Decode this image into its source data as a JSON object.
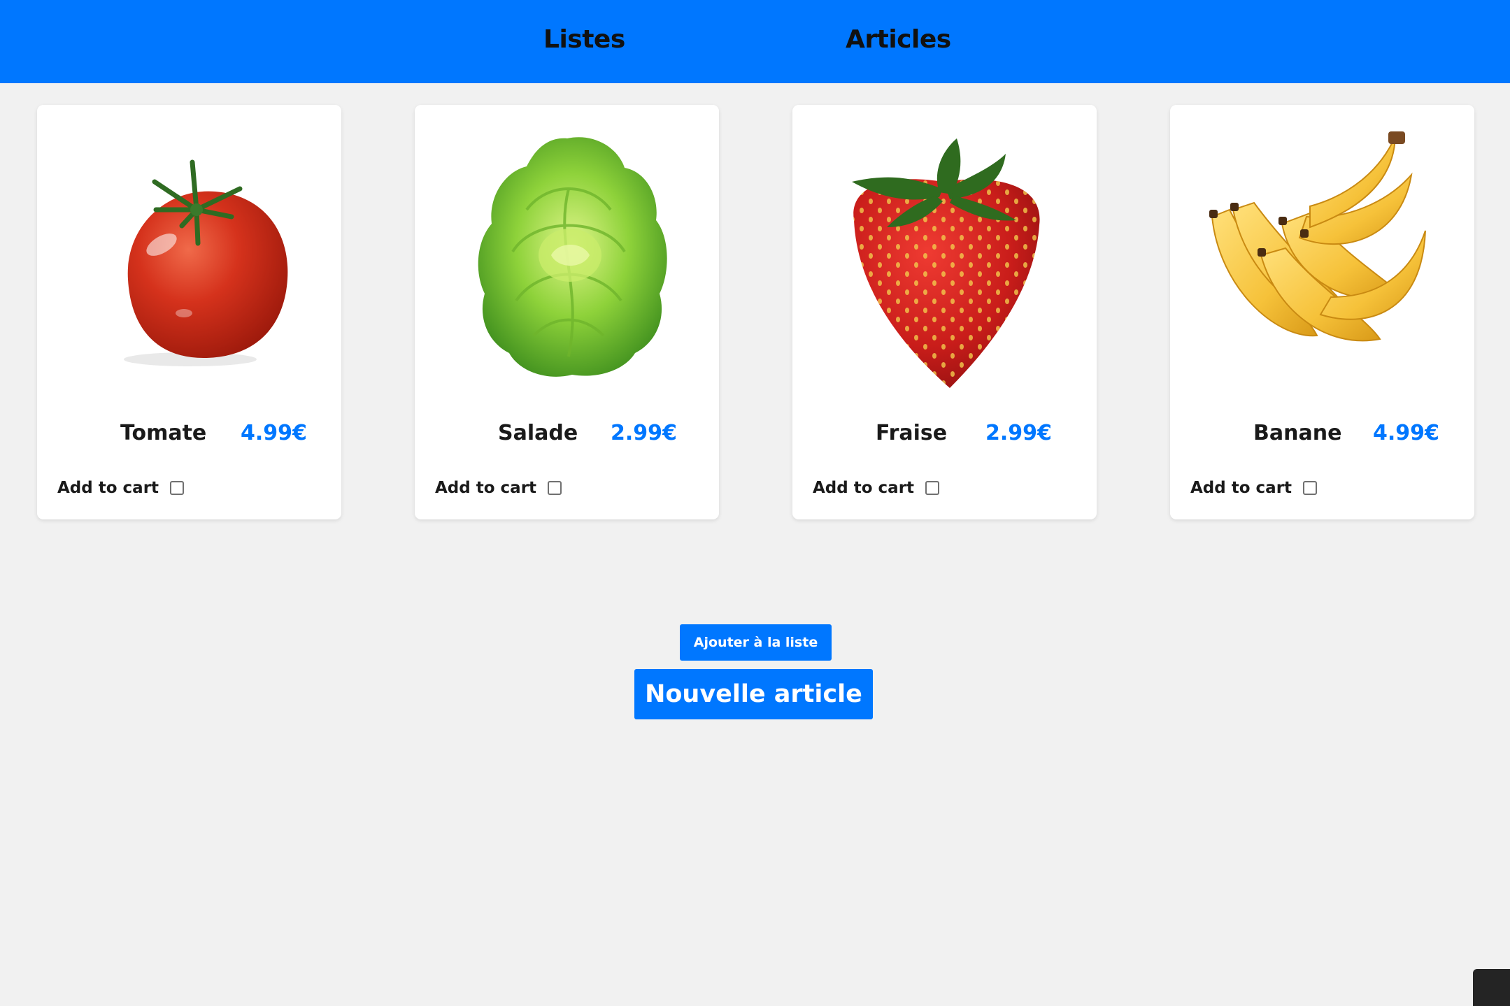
{
  "navbar": {
    "links": [
      {
        "label": "Listes"
      },
      {
        "label": "Articles"
      }
    ]
  },
  "products": [
    {
      "name": "Tomate",
      "price": "4.99€",
      "cart_label": "Add to cart",
      "in_cart": false,
      "icon": "tomato-image"
    },
    {
      "name": "Salade",
      "price": "2.99€",
      "cart_label": "Add to cart",
      "in_cart": false,
      "icon": "lettuce-image"
    },
    {
      "name": "Fraise",
      "price": "2.99€",
      "cart_label": "Add to cart",
      "in_cart": false,
      "icon": "strawberry-image"
    },
    {
      "name": "Banane",
      "price": "4.99€",
      "cart_label": "Add to cart",
      "in_cart": false,
      "icon": "banana-image"
    }
  ],
  "actions": {
    "add_to_list_label": "Ajouter à la liste",
    "new_article_label": "Nouvelle article"
  },
  "colors": {
    "accent": "#0077ff",
    "background": "#f1f1f1",
    "card": "#ffffff",
    "text": "#1a1a1a"
  }
}
